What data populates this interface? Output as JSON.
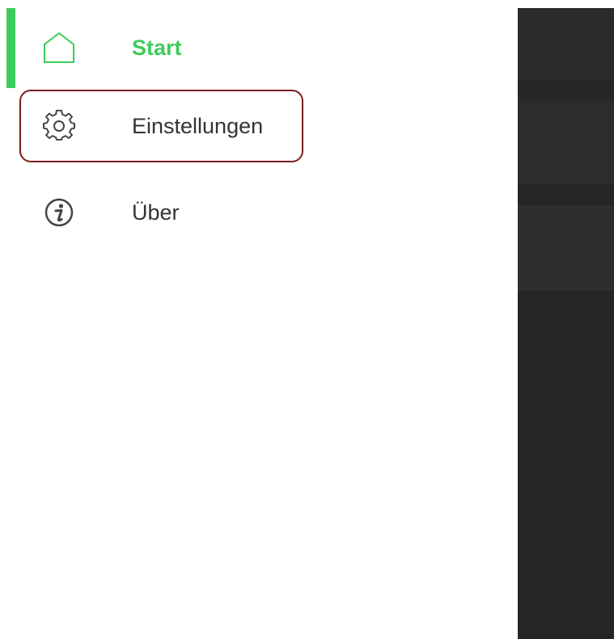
{
  "drawer": {
    "items": [
      {
        "label": "Start",
        "icon": "home-icon",
        "active": true
      },
      {
        "label": "Einstellungen",
        "icon": "gear-icon",
        "active": false,
        "highlighted": true
      },
      {
        "label": "Über",
        "icon": "info-icon",
        "active": false
      }
    ]
  },
  "colors": {
    "accent": "#3dcc5a",
    "text": "#333333",
    "highlight_border": "#7a1f1f",
    "overlay": "#2a2a2a"
  }
}
